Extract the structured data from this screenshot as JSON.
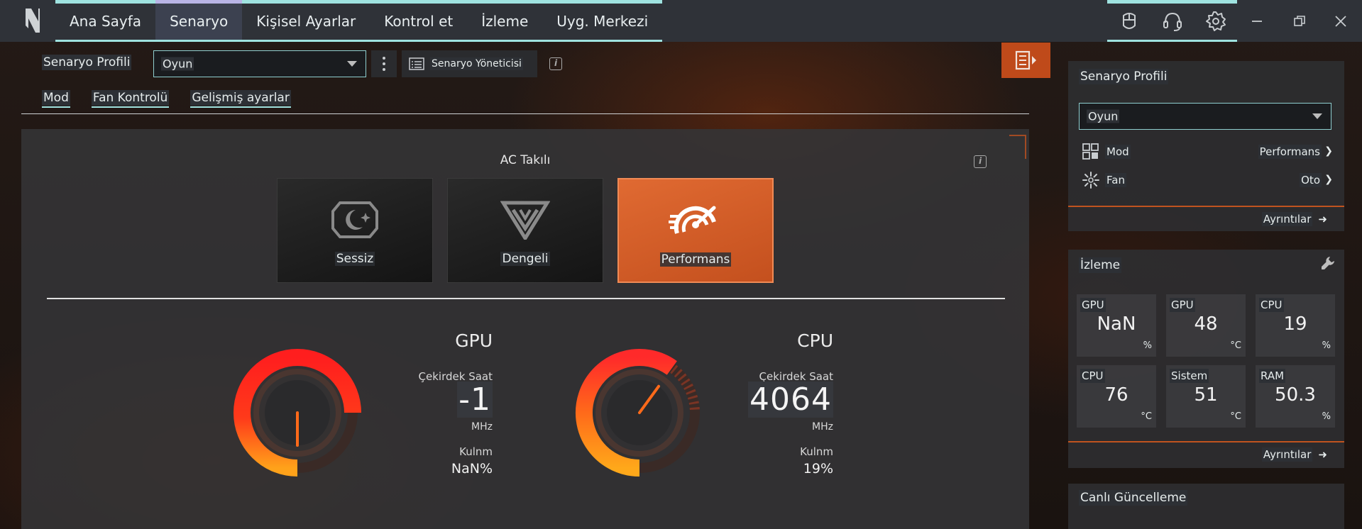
{
  "nav": {
    "items": [
      {
        "label": "Ana Sayfa"
      },
      {
        "label": "Senaryo"
      },
      {
        "label": "Kişisel Ayarlar"
      },
      {
        "label": "Kontrol et"
      },
      {
        "label": "İzleme"
      },
      {
        "label": "Uyg. Merkezi"
      }
    ],
    "active_index": 1
  },
  "scenario": {
    "label": "Senaryo Profili",
    "selected": "Oyun",
    "manager_label": "Senaryo Yöneticisi"
  },
  "subtabs": [
    "Mod",
    "Fan Kontrolü",
    "Gelişmiş ayarlar"
  ],
  "mode": {
    "power_label": "AC Takılı",
    "cards": [
      {
        "name": "Sessiz",
        "icon": "quiet-mode-icon",
        "selected": false
      },
      {
        "name": "Dengeli",
        "icon": "balanced-mode-icon",
        "selected": false
      },
      {
        "name": "Performans",
        "icon": "performance-mode-icon",
        "selected": true
      }
    ]
  },
  "gpu": {
    "title": "GPU",
    "clock_label": "Çekirdek Saat",
    "clock_value": "-1",
    "clock_unit": "MHz",
    "usage_label": "Kulnm",
    "usage_value": "NaN%",
    "gauge_fill": 1.0
  },
  "cpu": {
    "title": "CPU",
    "clock_label": "Çekirdek Saat",
    "clock_value": "4064",
    "clock_unit": "MHz",
    "usage_label": "Kulnm",
    "usage_value": "19%",
    "gauge_fill": 0.19
  },
  "side_profile": {
    "title": "Senaryo Profili",
    "selected": "Oyun",
    "rows": [
      {
        "label": "Mod",
        "value": "Performans",
        "icon": "mode-grid-icon"
      },
      {
        "label": "Fan",
        "value": "Oto",
        "icon": "fan-icon"
      }
    ],
    "details_label": "Ayrıntılar"
  },
  "monitor": {
    "title": "İzleme",
    "tiles": [
      {
        "label": "GPU",
        "value": "NaN",
        "unit": "%"
      },
      {
        "label": "GPU",
        "value": "48",
        "unit": "°C"
      },
      {
        "label": "CPU",
        "value": "19",
        "unit": "%"
      },
      {
        "label": "CPU",
        "value": "76",
        "unit": "°C"
      },
      {
        "label": "Sistem",
        "value": "51",
        "unit": "°C"
      },
      {
        "label": "RAM",
        "value": "50.3",
        "unit": "%"
      }
    ],
    "details_label": "Ayrıntılar"
  },
  "live_update": {
    "title": "Canlı Güncelleme"
  },
  "colors": {
    "accent": "#9fe3e0",
    "brand_orange": "#c4501e",
    "nav_active": "#b9b4e6"
  }
}
